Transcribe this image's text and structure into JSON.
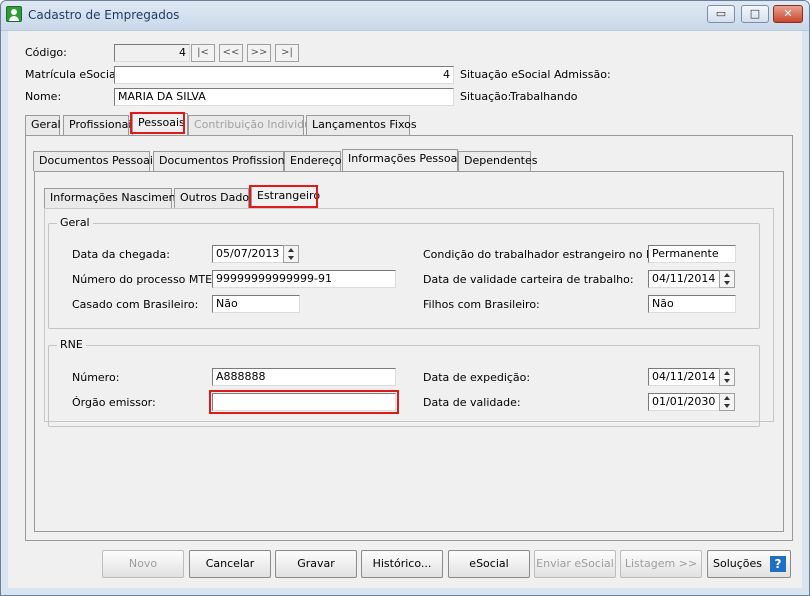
{
  "window": {
    "title": "Cadastro de Empregados",
    "min": "▭",
    "max": "□",
    "close": "✕"
  },
  "header": {
    "codigo_label": "Código:",
    "codigo_value": "4",
    "nav": [
      "|<",
      "<<",
      ">>",
      ">|"
    ],
    "matricula_label": "Matrícula eSocial:",
    "matricula_value": "4",
    "situacao_esocial_label": "Situação eSocial Admissão:",
    "nome_label": "Nome:",
    "nome_value": "MARIA DA SILVA",
    "situacao_label": "Situação:",
    "situacao_value": "Trabalhando"
  },
  "tabs_main": [
    "Geral",
    "Profissionais",
    "Pessoais",
    "Contribuição Individual",
    "Lançamentos Fixos"
  ],
  "tabs_sub": [
    "Documentos Pessoais",
    "Documentos Profissionais",
    "Endereço",
    "Informações Pessoais",
    "Dependentes"
  ],
  "tabs_info": [
    "Informações Nascimento",
    "Outros Dados",
    "Estrangeiro"
  ],
  "geral": {
    "title": "Geral",
    "data_chegada_label": "Data da chegada:",
    "data_chegada_value": "05/07/2013",
    "processo_label": "Número do processo MTE:",
    "processo_value": "99999999999999-91",
    "casado_label": "Casado com Brasileiro:",
    "casado_value": "Não",
    "condicao_label": "Condição do trabalhador estrangeiro no Brasil:",
    "condicao_value": "Permanente",
    "validade_carteira_label": "Data de validade carteira de trabalho:",
    "validade_carteira_value": "04/11/2014",
    "filhos_label": "Filhos com Brasileiro:",
    "filhos_value": "Não"
  },
  "rne": {
    "title": "RNE",
    "numero_label": "Número:",
    "numero_value": "A888888",
    "orgao_label": "Órgão emissor:",
    "orgao_value": "",
    "expedicao_label": "Data de expedição:",
    "expedicao_value": "04/11/2014",
    "validade_label": "Data de validade:",
    "validade_value": "01/01/2030"
  },
  "buttons": {
    "novo": "Novo",
    "cancelar": "Cancelar",
    "gravar": "Gravar",
    "historico": "Histórico...",
    "esocial": "eSocial",
    "enviar": "Enviar eSocial",
    "listagem": "Listagem >>",
    "solucoes": "Soluções",
    "help": "?"
  },
  "colors": {
    "highlight": "#e0191c"
  }
}
